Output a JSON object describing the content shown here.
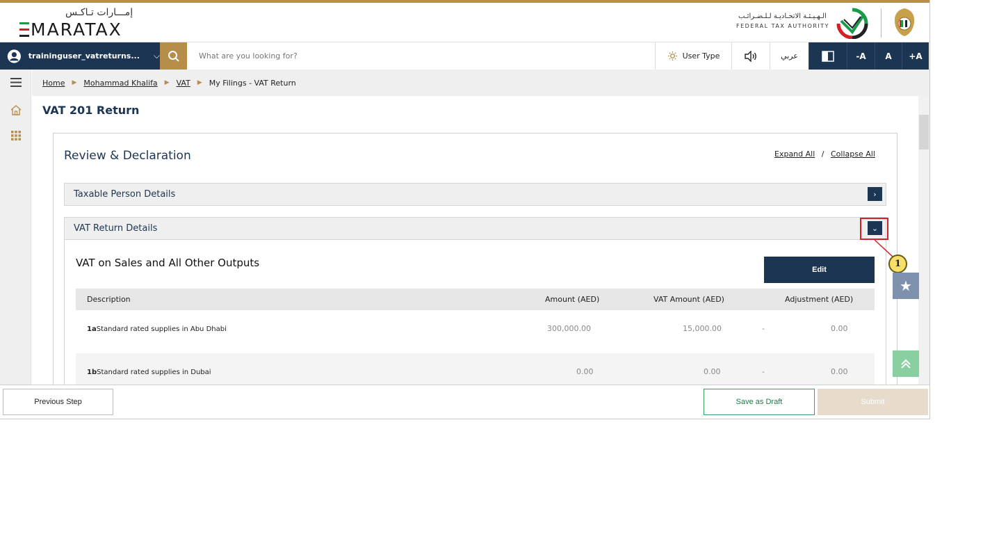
{
  "header": {
    "logo_ar": "إمـــارات تـاكـس",
    "logo_en": "MARATAX",
    "fta_ar": "الـهـيـئـة الاتحـاديـة لـلـضـرائـب",
    "fta_en": "FEDERAL TAX AUTHORITY"
  },
  "navbar": {
    "username": "traininguser_vatreturns...",
    "search_placeholder": "What are you looking for?",
    "user_type": "User Type",
    "arabic": "عربي",
    "font_decrease": "-A",
    "font_normal": "A",
    "font_increase": "+A"
  },
  "breadcrumb": {
    "home": "Home",
    "entity": "Mohammad Khalifa",
    "vat": "VAT",
    "current": "My Filings - VAT Return"
  },
  "page": {
    "title": "VAT 201 Return",
    "card_title": "Review & Declaration",
    "expand_all": "Expand All",
    "separator": "/",
    "collapse_all": "Collapse All"
  },
  "sections": {
    "taxable_person": "Taxable Person Details",
    "vat_return": "VAT Return Details",
    "sales_title": "VAT on Sales and All Other Outputs",
    "edit": "Edit"
  },
  "table": {
    "headers": [
      "Description",
      "Amount (AED)",
      "VAT Amount (AED)",
      "Adjustment (AED)"
    ],
    "rows": [
      {
        "code": "1a",
        "desc": "Standard rated supplies in Abu Dhabi",
        "amount": "300,000.00",
        "vat": "15,000.00",
        "dash": "-",
        "adjustment": "0.00"
      },
      {
        "code": "1b",
        "desc": "Standard rated supplies in Dubai",
        "amount": "0.00",
        "vat": "0.00",
        "dash": "-",
        "adjustment": "0.00"
      }
    ]
  },
  "annotation": {
    "callout": "1"
  },
  "footer": {
    "previous": "Previous Step",
    "save_draft": "Save as Draft",
    "submit": "Submit"
  },
  "colors": {
    "navy": "#1c3553",
    "gold": "#b78d4a",
    "highlight": "#d71f26"
  }
}
